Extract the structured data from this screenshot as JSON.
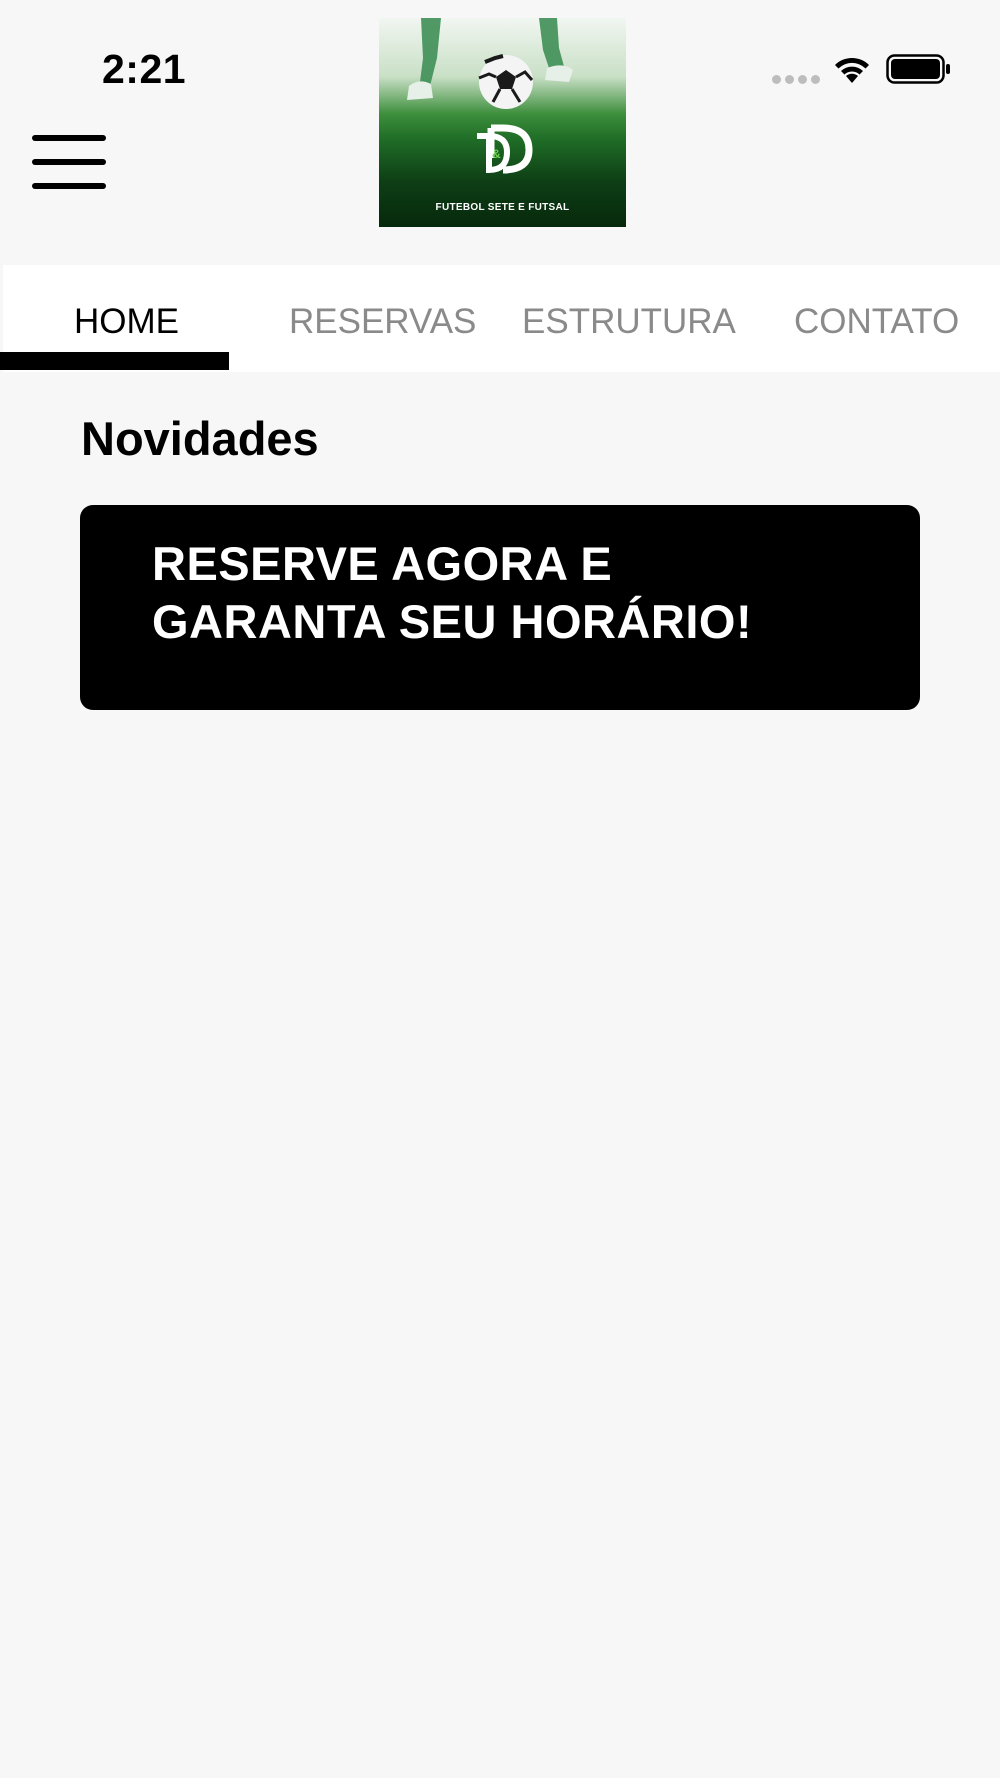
{
  "status_bar": {
    "time": "2:21",
    "icons": [
      "signal-dots-icon",
      "wifi-icon",
      "battery-icon"
    ]
  },
  "header": {
    "menu_icon": "hamburger-menu-icon",
    "logo": {
      "monogram": "D&D",
      "caption": "FUTEBOL SETE E FUTSAL"
    }
  },
  "tabs": [
    {
      "label": "HOME",
      "active": true
    },
    {
      "label": "RESERVAS",
      "active": false
    },
    {
      "label": "ESTRUTURA",
      "active": false
    },
    {
      "label": "CONTATO",
      "active": false
    }
  ],
  "main": {
    "section_title": "Novidades",
    "promo": {
      "line1": "RESERVE AGORA E",
      "line2": "GARANTA SEU HORÁRIO!"
    }
  },
  "colors": {
    "background": "#f7f7f7",
    "tab_bar": "#ffffff",
    "tab_active": "#000000",
    "tab_inactive": "#8a8a8a",
    "card": "#000000",
    "card_text": "#ffffff"
  }
}
